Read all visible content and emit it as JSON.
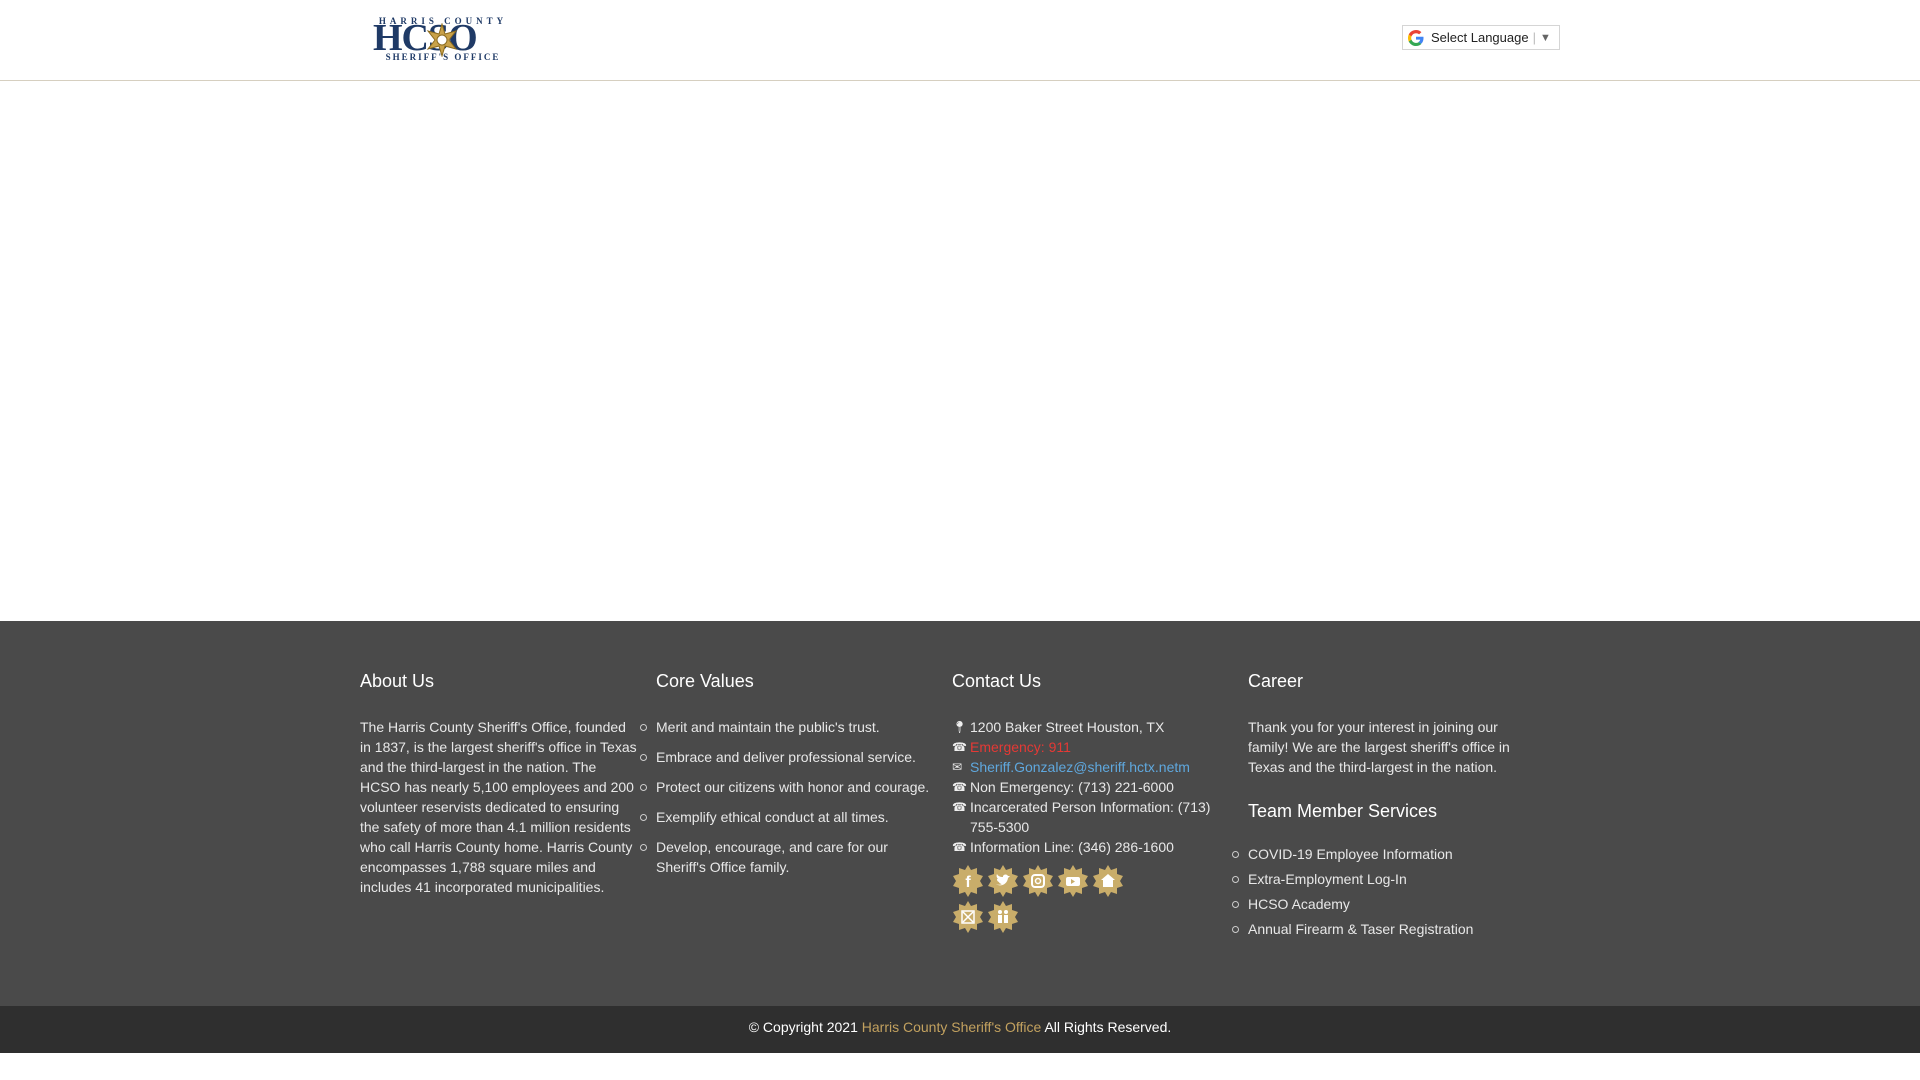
{
  "header": {
    "logo": {
      "top_text": "HARRIS COUNTY",
      "letters": "HCSO",
      "bottom_text": "SHERIFF'S OFFICE"
    },
    "language": {
      "label": "Select Language",
      "separator": "|",
      "arrow": "▼"
    }
  },
  "footer": {
    "about": {
      "title": "About Us",
      "text": "The Harris County Sheriff's Office, founded in 1837, is the largest sheriff's office in Texas and the third-largest in the nation. The HCSO has nearly 5,100 employees and 200 volunteer reservists dedicated to ensuring the safety of more than 4.1 million residents who call Harris County home. Harris County encompasses 1,788 square miles and includes 41 incorporated municipalities."
    },
    "core_values": {
      "title": "Core Values",
      "items": [
        "Merit and maintain the public's trust.",
        "Embrace and deliver professional service.",
        "Protect our citizens with honor and courage.",
        "Exemplify ethical conduct at all times.",
        "Develop, encourage, and care for our Sheriff's Office family."
      ]
    },
    "contact": {
      "title": "Contact Us",
      "address": "1200 Baker Street Houston, TX",
      "emergency": "Emergency: 911",
      "email": "Sheriff.Gonzalez@sheriff.hctx.netm",
      "non_emergency": "Non Emergency: (713) 221-6000",
      "incarcerated": "Incarcerated Person Information: (713) 755-5300",
      "info_line": "Information Line: (346) 286-1600",
      "social_icons": [
        "facebook-icon",
        "twitter-icon",
        "instagram-icon",
        "youtube-icon",
        "home-icon",
        "close-icon",
        "family-icon"
      ]
    },
    "career": {
      "title": "Career",
      "text": "Thank you for your interest in joining our family! We are the largest sheriff's office in Texas and the third-largest in the nation."
    },
    "team_services": {
      "title": "Team Member Services",
      "items": [
        "COVID-19 Employee Information",
        "Extra-Employment Log-In",
        "HCSO Academy",
        "Annual Firearm & Taser Registration"
      ]
    },
    "copyright": {
      "prefix": "© Copyright 2021 ",
      "brand": "Harris County Sheriff's Office",
      "suffix": " All Rights Reserved."
    }
  },
  "colors": {
    "footer_bg": "#4a4a4a",
    "copyright_bg": "#2f2f2f",
    "brand_gold": "#c2a15f",
    "badge_gold": "#c9ad6a",
    "emergency_red": "#e53935",
    "email_blue": "#5fa8de"
  }
}
